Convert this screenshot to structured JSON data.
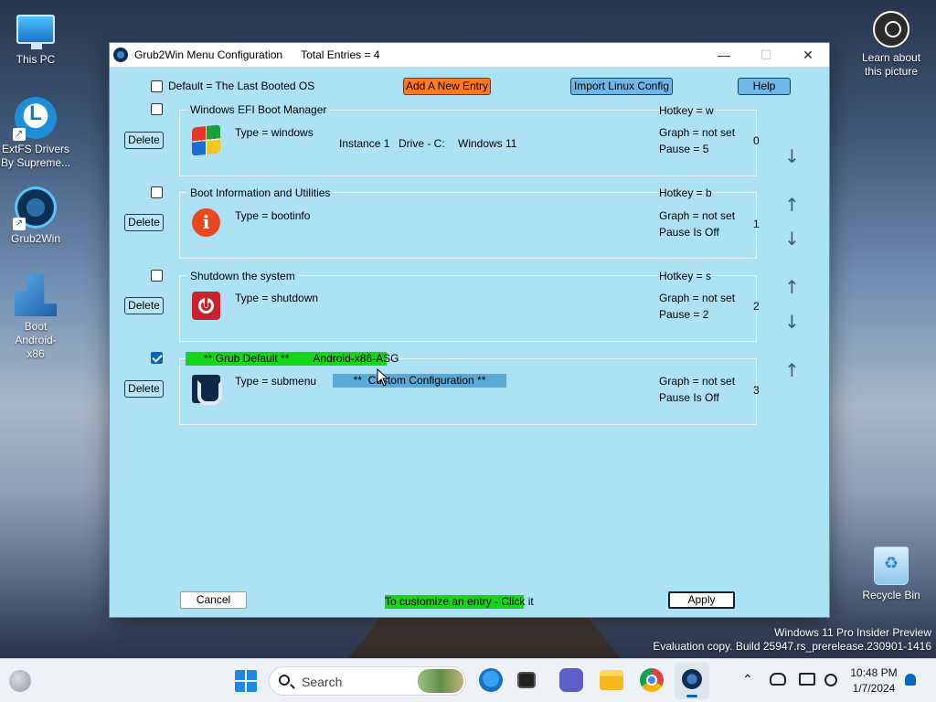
{
  "desktop": {
    "icons": [
      {
        "label": "This PC"
      },
      {
        "label": "ExtFS Drivers By Supreme..."
      },
      {
        "label": "Grub2Win"
      },
      {
        "label": "Boot Android-x86"
      },
      {
        "label": "Learn about this picture"
      },
      {
        "label": "Recycle Bin"
      }
    ],
    "watermark": {
      "line1": "Windows 11 Pro Insider Preview",
      "line2": "Evaluation copy. Build 25947.rs_prerelease.230901-1416"
    }
  },
  "window": {
    "title": "Grub2Win Menu Configuration",
    "total_entries": "Total Entries = 4",
    "controls": {
      "minimize": "—",
      "maximize": "☐",
      "close": "✕"
    },
    "default_checkbox_label": "Default = The Last Booted OS",
    "add_button": "Add A New Entry",
    "import_button": "Import Linux Config",
    "help_button": "Help",
    "delete_label": "Delete",
    "entries": [
      {
        "title": "Windows EFI Boot Manager",
        "type": "Type = windows",
        "instance": "Instance 1",
        "drive": "Drive - C:",
        "os": "Windows 11",
        "hotkey": "Hotkey = w",
        "graph": "Graph = not set",
        "pause": "Pause = 5",
        "index": "0",
        "checked": false,
        "icon": "windows-logo-icon"
      },
      {
        "title": "Boot Information and Utilities",
        "type": "Type = bootinfo",
        "hotkey": "Hotkey = b",
        "graph": "Graph = not set",
        "pause": "Pause Is Off",
        "index": "1",
        "checked": false,
        "icon": "info-icon"
      },
      {
        "title": "Shutdown the system",
        "type": "Type = shutdown",
        "hotkey": "Hotkey = s",
        "graph": "Graph = not set",
        "pause": "Pause = 2",
        "index": "2",
        "checked": false,
        "icon": "power-icon"
      },
      {
        "title": "** Grub Default **        Android-x86-ASG",
        "type": "Type = submenu",
        "custom": "**  Custom Configuration **",
        "graph": "Graph = not set",
        "pause": "Pause Is Off",
        "index": "3",
        "checked": true,
        "icon": "android-x86-icon"
      }
    ],
    "arrows": {
      "up": "↑",
      "down": "↓"
    },
    "cancel_button": "Cancel",
    "hint": "To customize an entry - Click it",
    "apply_button": "Apply"
  },
  "taskbar": {
    "search_placeholder": "Search",
    "time": "10:48 PM",
    "date": "1/7/2024"
  }
}
